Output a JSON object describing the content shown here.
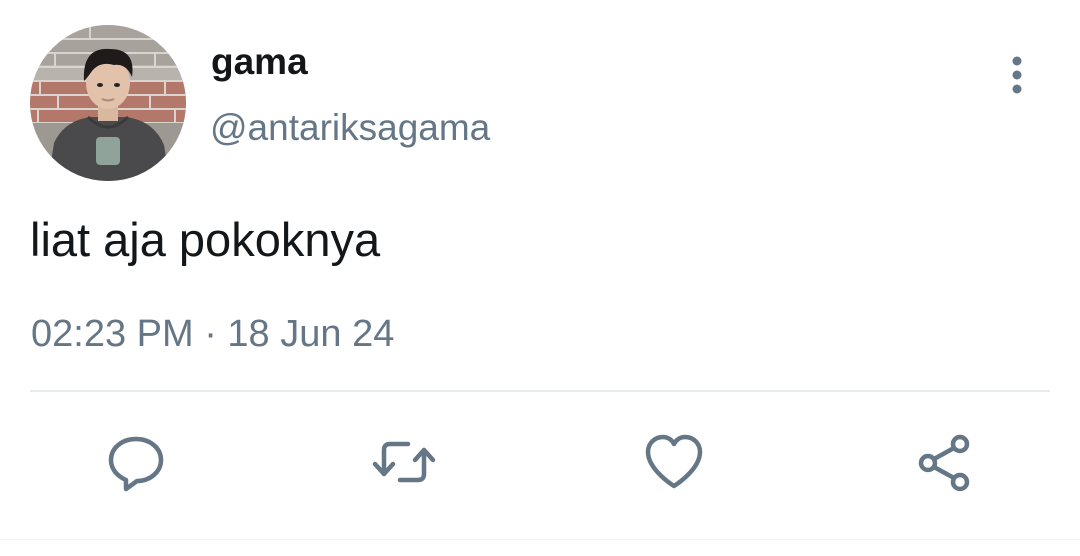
{
  "tweet": {
    "display_name": "gama",
    "handle": "@antariksagama",
    "text": "liat aja pokoknya",
    "timestamp": "02:23 PM · 18 Jun 24"
  },
  "icons": {
    "more": "more-vertical-icon",
    "reply": "reply-icon",
    "retweet": "retweet-icon",
    "like": "heart-icon",
    "share": "share-icon"
  },
  "colors": {
    "primary_text": "#14171a",
    "secondary_text": "#657786",
    "icon": "#657786",
    "divider": "#e6ecf0"
  }
}
